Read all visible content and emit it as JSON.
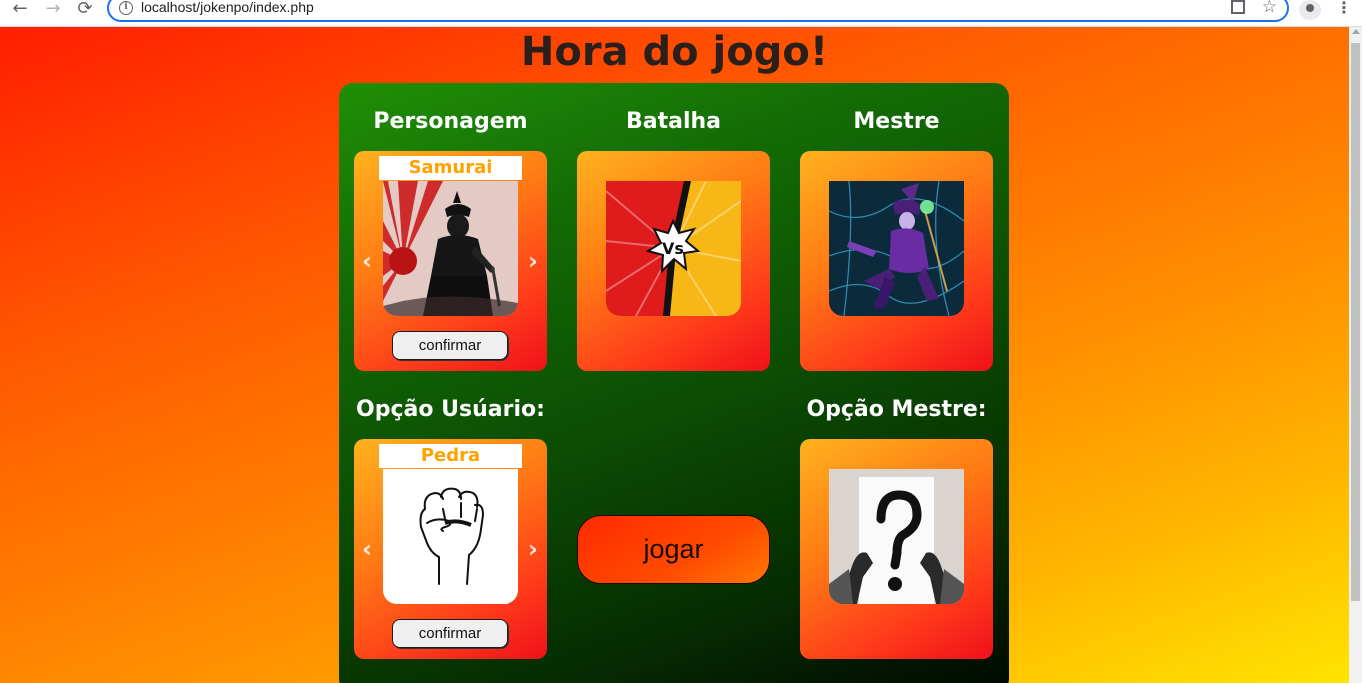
{
  "browser": {
    "url": "localhost/jokenpo/index.php",
    "back_glyph": "←",
    "forward_glyph": "→",
    "reload_glyph": "⟳",
    "info_glyph": "i",
    "star_glyph": "☆",
    "menu_glyph": "⋮"
  },
  "page": {
    "title": "Hora do jogo!"
  },
  "board": {
    "personagem_label": "Personagem",
    "batalha_label": "Batalha",
    "mestre_label": "Mestre",
    "opcao_usuario_label": "Opção Usúario:",
    "opcao_mestre_label": "Opção Mestre:",
    "character": {
      "name": "Samurai",
      "confirm_label": "confirmar"
    },
    "user_option": {
      "name": "Pedra",
      "confirm_label": "confirmar"
    },
    "play_label": "jogar",
    "arrow_prev": "‹",
    "arrow_next": "›"
  },
  "colors": {
    "caption_text": "#ffa200",
    "board_top": "#1f8f06",
    "board_bottom": "#000800",
    "page_gradient_start": "#ff1e00",
    "page_gradient_end": "#ffe400"
  },
  "icons": [
    "back-arrow-icon",
    "forward-arrow-icon",
    "reload-icon",
    "info-icon",
    "qr-code-icon",
    "bookmark-star-icon",
    "profile-avatar-icon",
    "menu-dots-icon",
    "chevron-left-icon",
    "chevron-right-icon"
  ]
}
